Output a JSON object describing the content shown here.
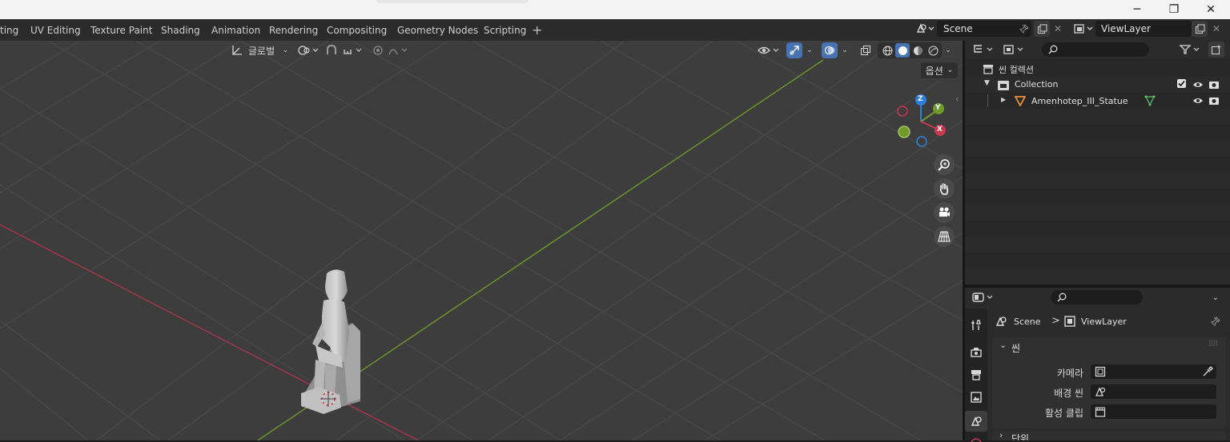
{
  "window": {
    "minimize_glyph": "─",
    "maximize_glyph": "❐",
    "close_glyph": "✕"
  },
  "workspaces": {
    "tabs": [
      "ting",
      "UV Editing",
      "Texture Paint",
      "Shading",
      "Animation",
      "Rendering",
      "Compositing",
      "Geometry Nodes",
      "Scripting"
    ],
    "add_glyph": "+"
  },
  "scene_selector": {
    "value": "Scene"
  },
  "viewlayer_selector": {
    "value": "ViewLayer"
  },
  "viewport": {
    "orientation_label": "글로벌",
    "options_label": "옵션",
    "gizmo": {
      "x": "X",
      "y": "Y",
      "z": "Z"
    },
    "axis_colors": {
      "x": "#c8384f",
      "y": "#6f9a2a",
      "z": "#2e7fd8"
    },
    "object": "Amenhotep_III_Statue"
  },
  "outliner": {
    "root": "씬 컬렉션",
    "collection": "Collection",
    "object": "Amenhotep_III_Statue"
  },
  "properties": {
    "breadcrumb": {
      "scene": "Scene",
      "separator": ">",
      "viewlayer": "ViewLayer"
    },
    "panel_title": "씬",
    "fields": [
      {
        "label": "카메라"
      },
      {
        "label": "배경 씬"
      },
      {
        "label": "활성 클립"
      }
    ],
    "next_panel": "단위"
  }
}
